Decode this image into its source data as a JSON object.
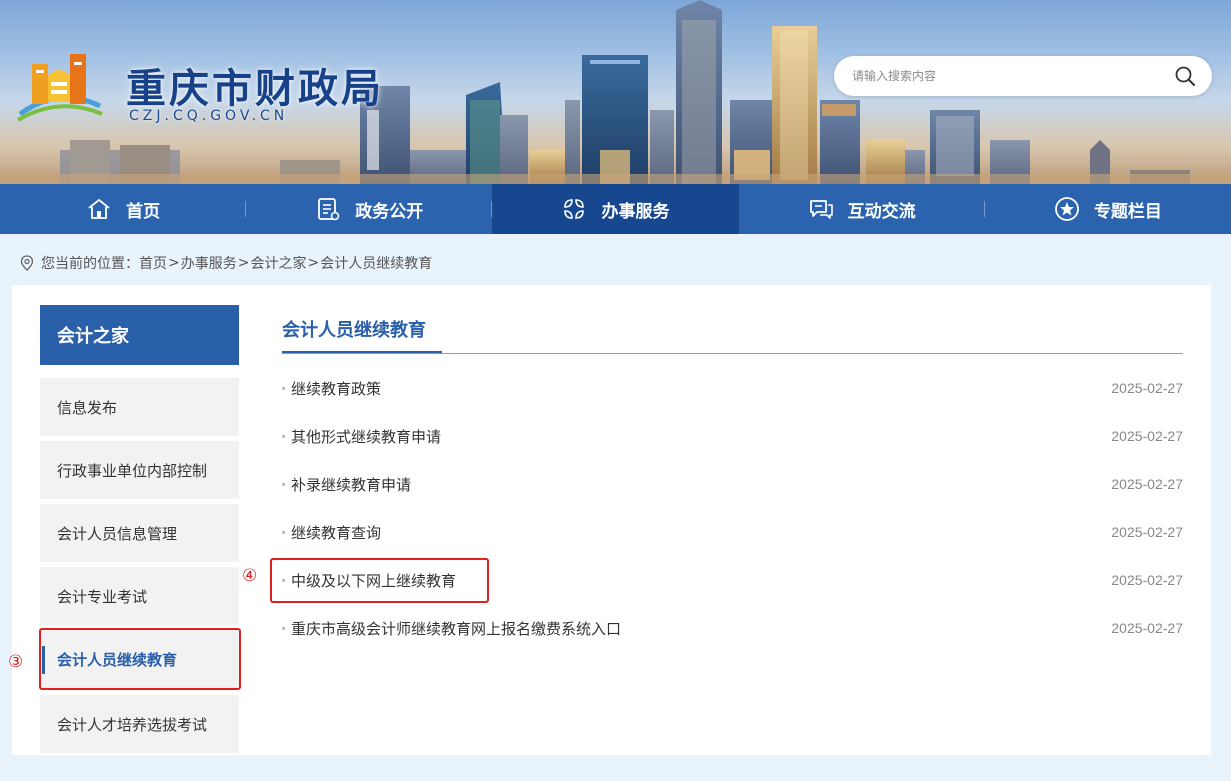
{
  "header": {
    "site_title": "重庆市财政局",
    "site_domain": "CZJ.CQ.GOV.CN",
    "logo_icon": "chongqing-finance-logo",
    "search": {
      "placeholder": "请输入搜索内容",
      "value": "",
      "icon": "search-icon"
    }
  },
  "nav": {
    "items": [
      {
        "label": "首页",
        "icon": "home-icon",
        "active": false
      },
      {
        "label": "政务公开",
        "icon": "document-list-icon",
        "active": false
      },
      {
        "label": "办事服务",
        "icon": "grid-flower-icon",
        "active": true
      },
      {
        "label": "互动交流",
        "icon": "chat-icon",
        "active": false
      },
      {
        "label": "专题栏目",
        "icon": "star-circle-icon",
        "active": false
      }
    ]
  },
  "breadcrumb": {
    "prefix": "您当前的位置：",
    "separator": ">",
    "items": [
      "首页",
      "办事服务",
      "会计之家",
      "会计人员继续教育"
    ]
  },
  "sidebar": {
    "title": "会计之家",
    "items": [
      {
        "label": "信息发布",
        "active": false
      },
      {
        "label": "行政事业单位内部控制",
        "active": false
      },
      {
        "label": "会计人员信息管理",
        "active": false
      },
      {
        "label": "会计专业考试",
        "active": false
      },
      {
        "label": "会计人员继续教育",
        "active": true
      },
      {
        "label": "会计人才培养选拔考试",
        "active": false
      }
    ]
  },
  "main": {
    "title": "会计人员继续教育",
    "articles": [
      {
        "title": "继续教育政策",
        "date": "2025-02-27"
      },
      {
        "title": "其他形式继续教育申请",
        "date": "2025-02-27"
      },
      {
        "title": "补录继续教育申请",
        "date": "2025-02-27"
      },
      {
        "title": "继续教育查询",
        "date": "2025-02-27"
      },
      {
        "title": "中级及以下网上继续教育",
        "date": "2025-02-27"
      },
      {
        "title": "重庆市高级会计师继续教育网上报名缴费系统入口",
        "date": "2025-02-27"
      }
    ]
  },
  "annotations": {
    "sidebar_marker": "③",
    "article_marker": "④"
  },
  "colors": {
    "nav_bg": "#2b63ae",
    "nav_active": "#16478f",
    "accent": "#2a5faa",
    "annotation": "#e02020"
  }
}
